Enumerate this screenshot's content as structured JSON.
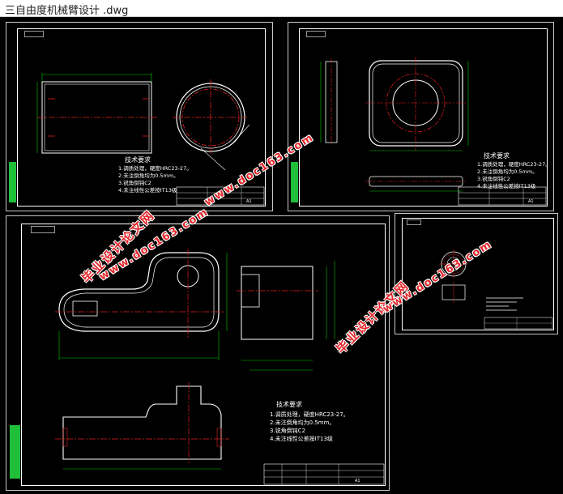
{
  "window": {
    "title": "三自由度机械臂设计 .dwg"
  },
  "sheets": {
    "s1": {
      "tag": "",
      "notes_title": "技术要求",
      "notes": [
        "1.调质处理，硬度HRC23-27。",
        "2.未注倒角均为0.5mm。",
        "3.锐角倒钝C2",
        "4.未注线性公差按IT13级"
      ],
      "tb_cell_a": "",
      "tb_cell_b": "A1"
    },
    "s2": {
      "tag": "",
      "notes_title": "技术要求",
      "notes": [
        "1.调质处理，硬度HRC23-27。",
        "2.未注倒角均为0.5mm。",
        "3.锐角倒钝C2",
        "4.未注线性公差按IT13级"
      ],
      "tb_cell_a": "",
      "tb_cell_b": "A1"
    },
    "s3": {
      "tag": "",
      "notes_title": "技术要求",
      "notes": [
        "1.调质处理，硬度HRC23-27。",
        "2.未注倒角均为0.5mm。",
        "3.锐角倒钝C2",
        "4.未注线性公差按IT13级"
      ],
      "tb_cell_a": "",
      "tb_cell_b": "A1"
    },
    "s4": {
      "tag": "",
      "notes_title": "",
      "notes": []
    }
  },
  "watermarks": {
    "cn": "毕业设计论文网",
    "url": "www.doc163.com"
  },
  "colors": {
    "background": "#000000",
    "outline": "#ffffff",
    "dimension": "#00c800",
    "centerline": "#e02020",
    "watermark": "#e4262b"
  }
}
